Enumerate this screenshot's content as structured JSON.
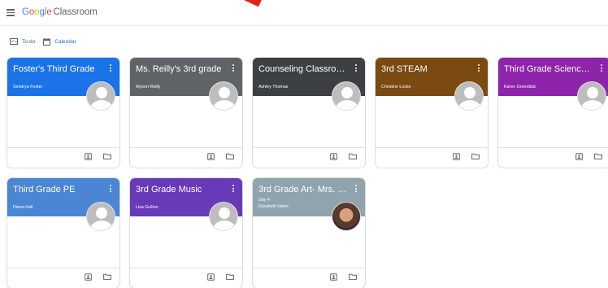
{
  "header": {
    "logo_google": [
      "G",
      "o",
      "o",
      "g",
      "l",
      "e"
    ],
    "product": "Classroom"
  },
  "subnav": {
    "todo": "To-do",
    "calendar": "Calendar"
  },
  "colors": {
    "accent_link": "#1967d2",
    "arrow": "#e0231c"
  },
  "cards": [
    {
      "title": "Foster's Third Grade",
      "subtitle": "",
      "teacher": "Seridrya Foster",
      "color": "#1a73e8",
      "avatar": "default"
    },
    {
      "title": "Ms. Reilly's 3rd grade",
      "subtitle": "",
      "teacher": "Alyson Reilly",
      "color": "#5f6368",
      "avatar": "default"
    },
    {
      "title": "Counseling Classroo...",
      "subtitle": "",
      "teacher": "Ashley Thomas",
      "color": "#3c4043",
      "avatar": "default"
    },
    {
      "title": "3rd STEAM",
      "subtitle": "",
      "teacher": "Christine Locke",
      "color": "#7a4a10",
      "avatar": "default"
    },
    {
      "title": "Third Grade Science ...",
      "subtitle": "",
      "teacher": "Karen Greenblat",
      "color": "#8e24aa",
      "avatar": "default"
    },
    {
      "title": "Third Grade PE",
      "subtitle": "",
      "teacher": "Diana Hall",
      "color": "#4a86d4",
      "avatar": "default"
    },
    {
      "title": "3rd Grade Music",
      "subtitle": "",
      "teacher": "Lisa Gullion",
      "color": "#673ab7",
      "avatar": "default"
    },
    {
      "title": "3rd Grade Art- Mrs. F...",
      "subtitle": "Day 4",
      "teacher": "Elizabeth Hians",
      "color": "#90a4ae",
      "avatar": "photo"
    }
  ]
}
